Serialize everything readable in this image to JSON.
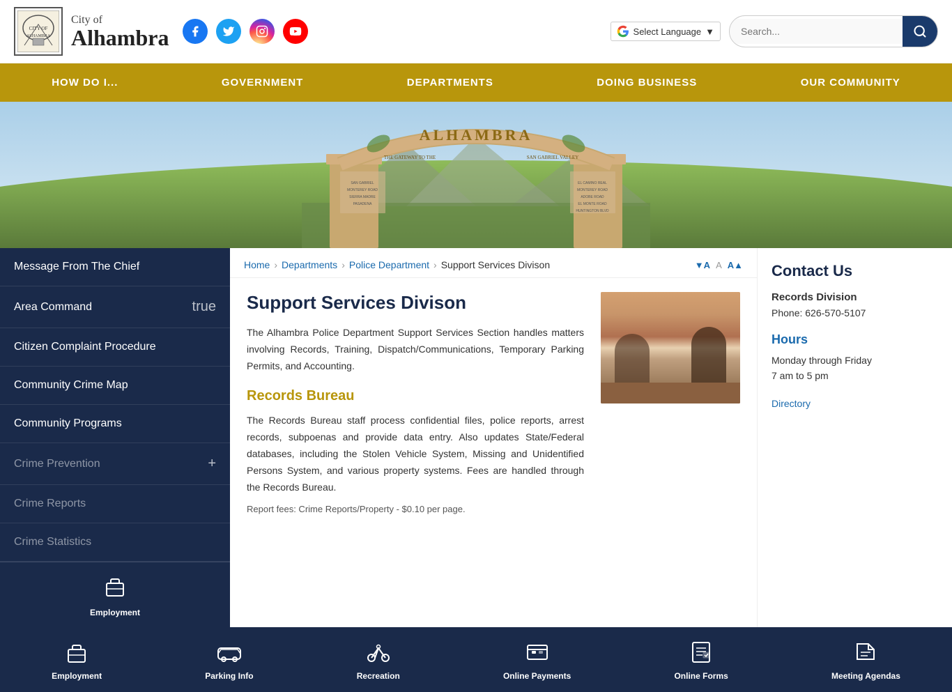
{
  "header": {
    "city_line1": "City of",
    "city_name": "Alhambra",
    "social": [
      {
        "name": "facebook",
        "class": "si-fb",
        "icon": "f"
      },
      {
        "name": "twitter",
        "class": "si-tw",
        "icon": "t"
      },
      {
        "name": "instagram",
        "class": "si-ig",
        "icon": "📷"
      },
      {
        "name": "youtube",
        "class": "si-yt",
        "icon": "▶"
      }
    ],
    "search_placeholder": "Search...",
    "language_label": "Select Language"
  },
  "nav": {
    "items": [
      {
        "label": "HOW DO I...",
        "id": "how-do-i"
      },
      {
        "label": "GOVERNMENT",
        "id": "government"
      },
      {
        "label": "DEPARTMENTS",
        "id": "departments"
      },
      {
        "label": "DOING BUSINESS",
        "id": "doing-business"
      },
      {
        "label": "OUR COMMUNITY",
        "id": "our-community"
      }
    ]
  },
  "sidebar": {
    "items": [
      {
        "label": "Message From The Chief",
        "has_plus": false,
        "dim": false
      },
      {
        "label": "Area Command",
        "has_plus": true,
        "dim": false
      },
      {
        "label": "Citizen Complaint Procedure",
        "has_plus": false,
        "dim": false
      },
      {
        "label": "Community Crime Map",
        "has_plus": false,
        "dim": false
      },
      {
        "label": "Community Programs",
        "has_plus": false,
        "dim": false
      },
      {
        "label": "Crime Prevention",
        "has_plus": true,
        "dim": true
      },
      {
        "label": "Crime Reports",
        "has_plus": false,
        "dim": true
      },
      {
        "label": "Crime Statistics",
        "has_plus": false,
        "dim": true
      }
    ]
  },
  "breadcrumb": {
    "items": [
      {
        "label": "Home",
        "link": true
      },
      {
        "label": "Departments",
        "link": true
      },
      {
        "label": "Police Department",
        "link": true
      },
      {
        "label": "Support Services Divison",
        "link": false
      }
    ]
  },
  "font_controls": {
    "decrease": "▼A",
    "increase": "A▲"
  },
  "page": {
    "title": "Support Services Divison",
    "description": "The Alhambra Police Department Support Services Section handles matters involving Records, Training, Dispatch/Communications, Temporary Parking Permits, and Accounting.",
    "section_title": "Records Bureau",
    "section_description": "The Records Bureau staff process confidential files, police reports, arrest records, subpoenas and provide data entry. Also updates State/Federal databases, including the Stolen Vehicle System, Missing and Unidentified Persons System, and various property systems. Fees are handled through the Records Bureau.",
    "fees_note": "Report fees: Crime Reports/Property - $0.10 per page."
  },
  "contact": {
    "title": "Contact Us",
    "section_label": "Records Division",
    "phone_label": "Phone:",
    "phone": "626-570-5107",
    "hours_title": "Hours",
    "hours_days": "Monday through Friday",
    "hours_time": "7 am to 5 pm",
    "directory_label": "Directory"
  },
  "dock": {
    "items": [
      {
        "label": "Employment",
        "icon": "💼",
        "id": "employment"
      },
      {
        "label": "Parking Info",
        "icon": "🚗",
        "id": "parking-info"
      },
      {
        "label": "Recreation",
        "icon": "🚲",
        "id": "recreation"
      },
      {
        "label": "Online Payments",
        "icon": "🖥",
        "id": "online-payments"
      },
      {
        "label": "Online Forms",
        "icon": "📋",
        "id": "online-forms"
      },
      {
        "label": "Meeting Agendas",
        "icon": "📁",
        "id": "meeting-agendas"
      }
    ]
  }
}
